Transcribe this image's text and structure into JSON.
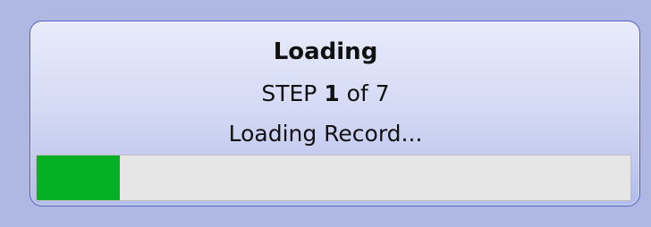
{
  "dialog": {
    "title": "Loading",
    "step": {
      "prefix": "STEP",
      "current": "1",
      "separator": "of",
      "total": "7"
    },
    "status_text": "Loading Record...",
    "progress": {
      "fraction": 0.14,
      "fill_color": "#06b025",
      "track_color": "#e6e6e6"
    }
  },
  "colors": {
    "background": "#aeb8e3",
    "panel_border": "#5460b8"
  }
}
